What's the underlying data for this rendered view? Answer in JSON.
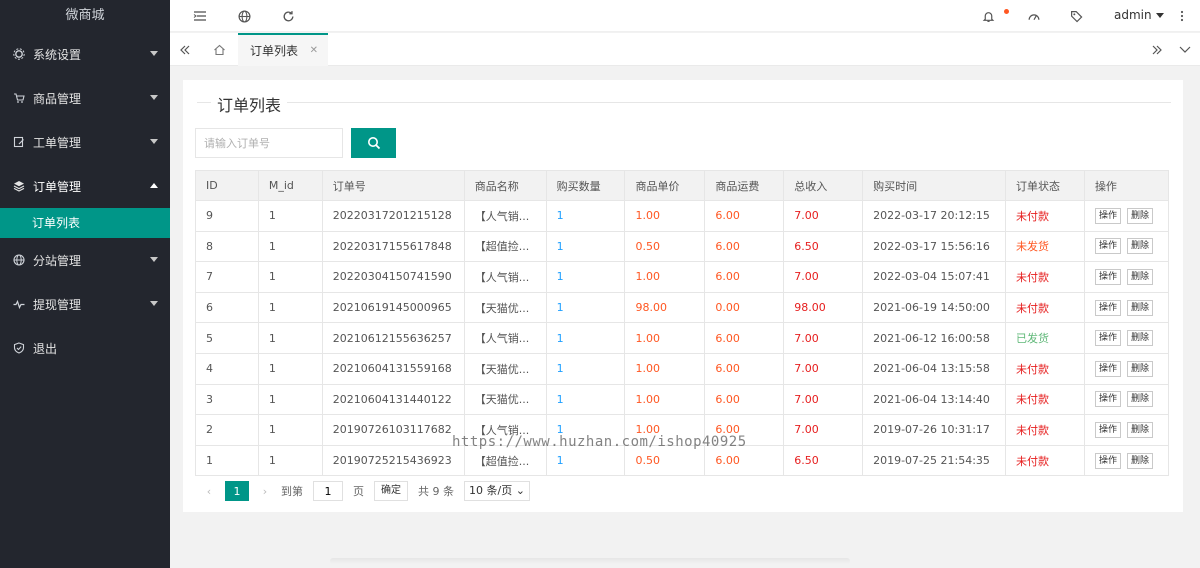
{
  "sidebar": {
    "logo": "微商城",
    "items": [
      {
        "label": "系统设置",
        "icon": "gear-icon"
      },
      {
        "label": "商品管理",
        "icon": "cart-icon"
      },
      {
        "label": "工单管理",
        "icon": "edit-icon"
      },
      {
        "label": "订单管理",
        "icon": "layers-icon"
      },
      {
        "label": "分站管理",
        "icon": "globe-icon"
      },
      {
        "label": "提现管理",
        "icon": "pulse-icon"
      },
      {
        "label": "退出",
        "icon": "shield-icon"
      }
    ],
    "subitem": "订单列表"
  },
  "header": {
    "user": "admin"
  },
  "tabs": {
    "active": "订单列表"
  },
  "card": {
    "title": "订单列表",
    "search_placeholder": "请输入订单号"
  },
  "table": {
    "headers": [
      "ID",
      "M_id",
      "订单号",
      "商品名称",
      "购买数量",
      "商品单价",
      "商品运费",
      "总收入",
      "购买时间",
      "订单状态",
      "操作"
    ],
    "rows": [
      {
        "id": "9",
        "mid": "1",
        "order": "20220317201215128",
        "name": "【人气销...",
        "qty": "1",
        "price": "1.00",
        "ship": "6.00",
        "total": "7.00",
        "time": "2022-03-17 20:12:15",
        "status": "未付款",
        "status_type": "red"
      },
      {
        "id": "8",
        "mid": "1",
        "order": "20220317155617848",
        "name": "【超值捡...",
        "qty": "1",
        "price": "0.50",
        "ship": "6.00",
        "total": "6.50",
        "time": "2022-03-17 15:56:16",
        "status": "未发货",
        "status_type": "orange"
      },
      {
        "id": "7",
        "mid": "1",
        "order": "20220304150741590",
        "name": "【人气销...",
        "qty": "1",
        "price": "1.00",
        "ship": "6.00",
        "total": "7.00",
        "time": "2022-03-04 15:07:41",
        "status": "未付款",
        "status_type": "red"
      },
      {
        "id": "6",
        "mid": "1",
        "order": "20210619145000965",
        "name": "【天猫优...",
        "qty": "1",
        "price": "98.00",
        "ship": "0.00",
        "total": "98.00",
        "time": "2021-06-19 14:50:00",
        "status": "未付款",
        "status_type": "red"
      },
      {
        "id": "5",
        "mid": "1",
        "order": "20210612155636257",
        "name": "【人气销...",
        "qty": "1",
        "price": "1.00",
        "ship": "6.00",
        "total": "7.00",
        "time": "2021-06-12 16:00:58",
        "status": "已发货",
        "status_type": "green"
      },
      {
        "id": "4",
        "mid": "1",
        "order": "20210604131559168",
        "name": "【天猫优...",
        "qty": "1",
        "price": "1.00",
        "ship": "6.00",
        "total": "7.00",
        "time": "2021-06-04 13:15:58",
        "status": "未付款",
        "status_type": "red"
      },
      {
        "id": "3",
        "mid": "1",
        "order": "20210604131440122",
        "name": "【天猫优...",
        "qty": "1",
        "price": "1.00",
        "ship": "6.00",
        "total": "7.00",
        "time": "2021-06-04 13:14:40",
        "status": "未付款",
        "status_type": "red"
      },
      {
        "id": "2",
        "mid": "1",
        "order": "20190726103117682",
        "name": "【人气销...",
        "qty": "1",
        "price": "1.00",
        "ship": "6.00",
        "total": "7.00",
        "time": "2019-07-26 10:31:17",
        "status": "未付款",
        "status_type": "red"
      },
      {
        "id": "1",
        "mid": "1",
        "order": "20190725215436923",
        "name": "【超值捡...",
        "qty": "1",
        "price": "0.50",
        "ship": "6.00",
        "total": "6.50",
        "time": "2019-07-25 21:54:35",
        "status": "未付款",
        "status_type": "red"
      }
    ],
    "op_label": "操作",
    "delete_label": "删除"
  },
  "pager": {
    "current": "1",
    "goto_label": "到第",
    "goto_value": "1",
    "page_label": "页",
    "confirm_label": "确定",
    "total": "共 9 条",
    "page_size": "10 条/页"
  },
  "watermark": "https://www.huzhan.com/ishop40925"
}
